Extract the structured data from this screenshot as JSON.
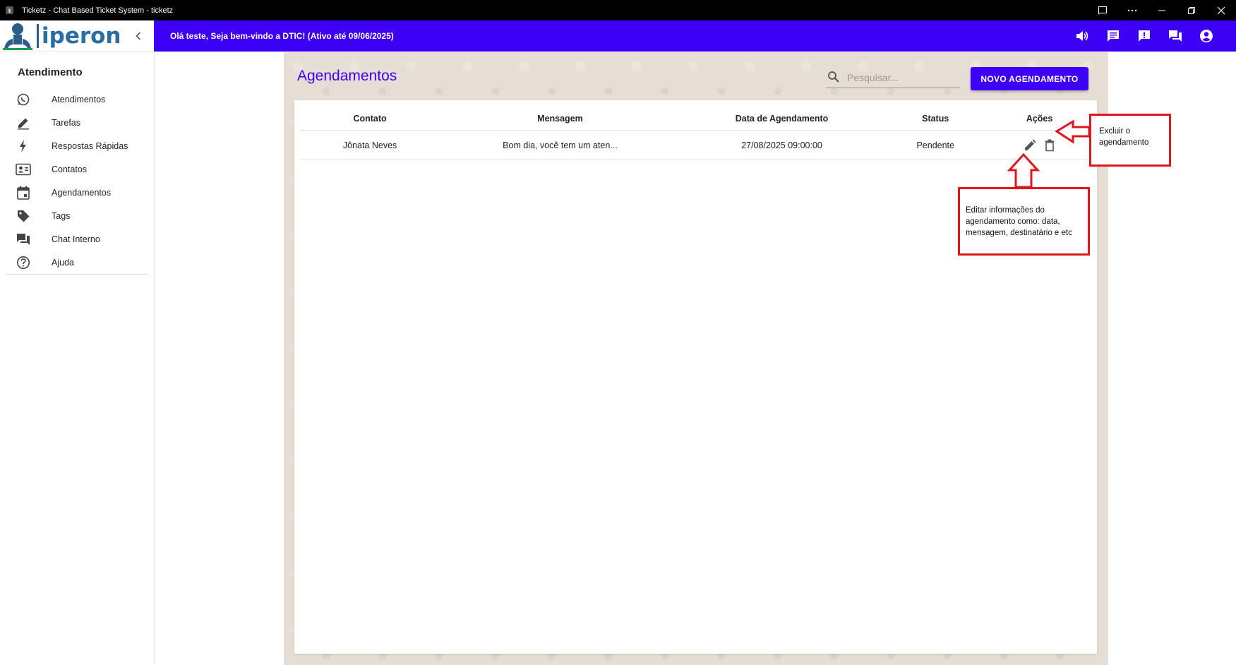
{
  "window": {
    "title": "Ticketz - Chat Based Ticket System - ticketz",
    "controls": [
      "cast-icon",
      "more-icon",
      "minimize-icon",
      "restore-icon",
      "close-icon"
    ]
  },
  "brand": {
    "logo_text": "iperon"
  },
  "appbar": {
    "welcome": "Olá teste, Seja bem-vindo a DTIC! (Ativo até 09/06/2025)",
    "actions": [
      "volume-icon",
      "chat-icon",
      "announcement-icon",
      "forum-icon",
      "account-icon"
    ]
  },
  "sidebar": {
    "section_title": "Atendimento",
    "items": [
      {
        "label": "Atendimentos",
        "icon": "whatsapp-icon"
      },
      {
        "label": "Tarefas",
        "icon": "pencil-icon"
      },
      {
        "label": "Respostas Rápidas",
        "icon": "bolt-icon"
      },
      {
        "label": "Contatos",
        "icon": "contacts-icon"
      },
      {
        "label": "Agendamentos",
        "icon": "calendar-icon"
      },
      {
        "label": "Tags",
        "icon": "tag-icon"
      },
      {
        "label": "Chat Interno",
        "icon": "forum-icon"
      },
      {
        "label": "Ajuda",
        "icon": "help-icon"
      }
    ]
  },
  "page": {
    "title": "Agendamentos",
    "search_placeholder": "Pesquisar...",
    "new_button": "NOVO AGENDAMENTO"
  },
  "table": {
    "columns": [
      "Contato",
      "Mensagem",
      "Data de Agendamento",
      "Status",
      "Ações"
    ],
    "rows": [
      {
        "contato": "Jônata Neves",
        "mensagem": "Bom dia, você tem um aten...",
        "data": "27/08/2025 09:00:00",
        "status": "Pendente"
      }
    ]
  },
  "annotations": {
    "delete_line1": "Excluir o",
    "delete_line2": "agendamento",
    "edit_line1": "Editar informações do",
    "edit_line2": "agendamento como: data,",
    "edit_line3": "mensagem, destinatário e etc",
    "color": "#e0161f"
  },
  "colors": {
    "accent": "#3d00f5",
    "background": "#e6ded5"
  }
}
